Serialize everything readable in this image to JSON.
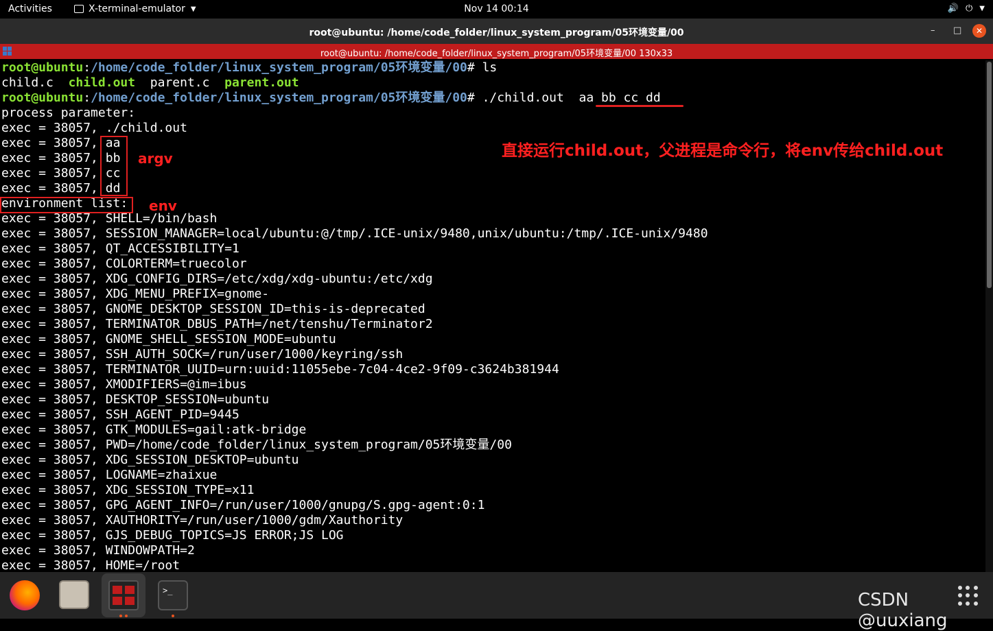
{
  "topbar": {
    "activities": "Activities",
    "app_name": "X-terminal-emulator",
    "clock": "Nov 14  00:14"
  },
  "window": {
    "title": "root@ubuntu: /home/code_folder/linux_system_program/05环境变量/00",
    "terminal_title": "root@ubuntu: /home/code_folder/linux_system_program/05环境变量/00 130x33"
  },
  "terminal": {
    "prompt_user": "root@ubuntu",
    "prompt_path": "/home/code_folder/linux_system_program/05环境变量/00",
    "cmd1": "ls",
    "ls_out": {
      "f1": "child.c",
      "f2": "child.out",
      "f3": "parent.c",
      "f4": "parent.out"
    },
    "cmd2": "./child.out",
    "cmd2_args": "aa bb cc dd",
    "line_process": "process parameter:",
    "prefix": "exec = 38057,",
    "argv": [
      "./child.out",
      "aa",
      "bb",
      "cc",
      "dd"
    ],
    "env_header": "environment list:",
    "env_lines": [
      "SHELL=/bin/bash",
      "SESSION_MANAGER=local/ubuntu:@/tmp/.ICE-unix/9480,unix/ubuntu:/tmp/.ICE-unix/9480",
      "QT_ACCESSIBILITY=1",
      "COLORTERM=truecolor",
      "XDG_CONFIG_DIRS=/etc/xdg/xdg-ubuntu:/etc/xdg",
      "XDG_MENU_PREFIX=gnome-",
      "GNOME_DESKTOP_SESSION_ID=this-is-deprecated",
      "TERMINATOR_DBUS_PATH=/net/tenshu/Terminator2",
      "GNOME_SHELL_SESSION_MODE=ubuntu",
      "SSH_AUTH_SOCK=/run/user/1000/keyring/ssh",
      "TERMINATOR_UUID=urn:uuid:11055ebe-7c04-4ce2-9f09-c3624b381944",
      "XMODIFIERS=@im=ibus",
      "DESKTOP_SESSION=ubuntu",
      "SSH_AGENT_PID=9445",
      "GTK_MODULES=gail:atk-bridge",
      "PWD=/home/code_folder/linux_system_program/05环境变量/00",
      "XDG_SESSION_DESKTOP=ubuntu",
      "LOGNAME=zhaixue",
      "XDG_SESSION_TYPE=x11",
      "GPG_AGENT_INFO=/run/user/1000/gnupg/S.gpg-agent:0:1",
      "XAUTHORITY=/run/user/1000/gdm/Xauthority",
      "GJS_DEBUG_TOPICS=JS ERROR;JS LOG",
      "WINDOWPATH=2",
      "HOME=/root"
    ]
  },
  "annotations": {
    "argv": "argv",
    "env": "env",
    "note": "直接运行child.out，父进程是命令行，将env传给child.out"
  },
  "watermark": "CSDN @uuxiang",
  "colors": {
    "accent_red": "#e02020",
    "prompt_green": "#8ae234",
    "prompt_blue": "#729fcf",
    "term_bar": "#c01c1c"
  },
  "icons": {
    "firefox": "firefox-icon",
    "files": "files-icon",
    "terminator": "terminator-icon",
    "terminal": "terminal-icon",
    "apps": "show-apps-icon"
  }
}
